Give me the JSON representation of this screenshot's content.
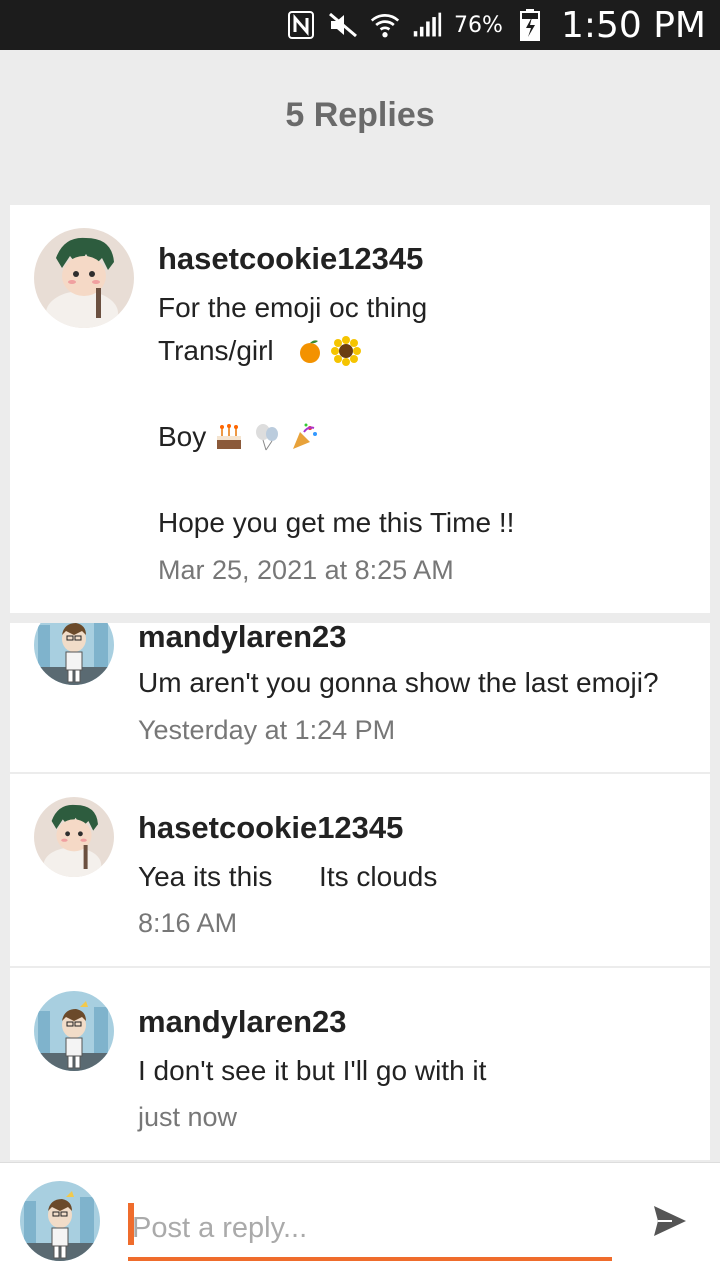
{
  "status_bar": {
    "battery": "76%",
    "time": "1:50 PM"
  },
  "header": {
    "title": "5 Replies"
  },
  "parent_comment": {
    "username": "hasetcookie12345",
    "lines": [
      "For the emoji oc thing",
      "Trans/girl",
      "",
      "Boy",
      "",
      "Hope you get me this Time !!"
    ],
    "timestamp": "Mar 25, 2021 at 8:25 AM"
  },
  "replies": [
    {
      "username": "mandylaren23",
      "text": "Um aren't you gonna show the last emoji?",
      "timestamp": "Yesterday at 1:24 PM"
    },
    {
      "username": "hasetcookie12345",
      "text": "Yea its this      Its clouds",
      "timestamp": "8:16 AM"
    },
    {
      "username": "mandylaren23",
      "text": "I don't see it but I'll go with it",
      "timestamp": "just now"
    }
  ],
  "composer": {
    "placeholder": "Post a reply..."
  },
  "colors": {
    "accent": "#ef6c2c",
    "background": "#ececec",
    "status_bar": "#1c1c1c"
  },
  "icons": [
    "nfc-icon",
    "mute-icon",
    "wifi-icon",
    "signal-icon",
    "battery-icon",
    "send-icon"
  ]
}
